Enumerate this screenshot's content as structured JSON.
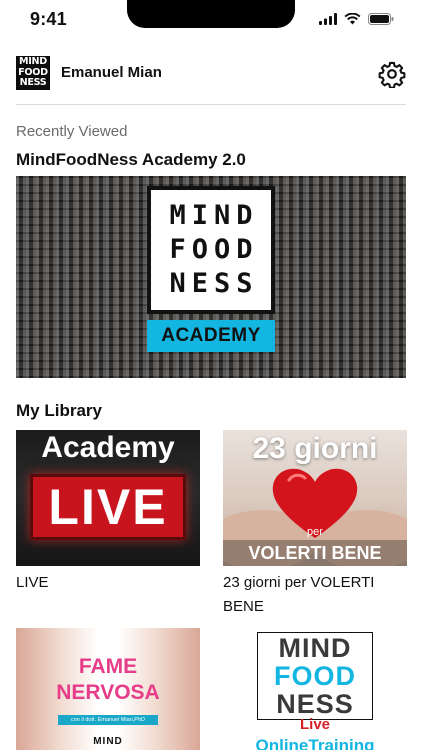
{
  "status_bar": {
    "time": "9:41",
    "icons": [
      "signal-icon",
      "wifi-icon",
      "battery-icon"
    ]
  },
  "header": {
    "logo_lines": [
      "MIND",
      "FOOD",
      "NESS"
    ],
    "user_name": "Emanuel Mian",
    "settings_icon": "gear-icon"
  },
  "recent": {
    "section_label": "Recently Viewed",
    "course_title": "MindFoodNess Academy 2.0",
    "hero_logo_lines": [
      "MIND",
      "FOOD",
      "NESS"
    ],
    "hero_badge": "ACADEMY"
  },
  "library": {
    "title": "My Library",
    "items": [
      {
        "label": "LIVE",
        "image_top": "Academy",
        "image_main": "LIVE"
      },
      {
        "label": "23 giorni per VOLERTI BENE",
        "image_top": "23 giorni",
        "image_per": "per",
        "image_bottom": "VOLERTI BENE"
      },
      {
        "label": "",
        "image_top": "FAME NERVOSA",
        "image_tag": "con il dott. Emanuel Mian,PhD",
        "image_bottom": "MIND"
      },
      {
        "label": "",
        "image_logo_lines": [
          "MIND",
          "FOOD",
          "NESS"
        ],
        "image_live": "Live",
        "image_bottom": "OnlineTraining"
      }
    ]
  },
  "colors": {
    "accent_cyan": "#13b6e0",
    "live_red": "#c8141c",
    "fame_pink": "#e63d8a"
  }
}
